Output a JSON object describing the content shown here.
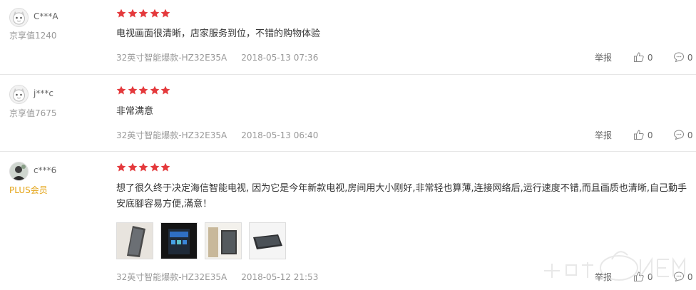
{
  "reviews": [
    {
      "user": "C***A",
      "level": "京享值1240",
      "rating": 5,
      "comment": "电视画面很清晰，店家服务到位，不错的购物体验",
      "product": "32英寸智能爆款-HZ32E35A",
      "date": "2018-05-13 07:36",
      "report_label": "举报",
      "likes": "0",
      "replies": "0"
    },
    {
      "user": "j***c",
      "level": "京享值7675",
      "rating": 5,
      "comment": "非常满意",
      "product": "32英寸智能爆款-HZ32E35A",
      "date": "2018-05-13 06:40",
      "report_label": "举报",
      "likes": "0",
      "replies": "0"
    },
    {
      "user": "c***6",
      "level": "PLUS会员",
      "rating": 5,
      "comment": "想了很久终于决定海信智能电视, 因为它是今年新款电视,房间用大小刚好,非常轻也算薄,连接网络后,运行速度不错,而且画质也清晰,自己動手安底腳容易方便,滿意！",
      "product": "32英寸智能爆款-HZ32E35A",
      "date": "2018-05-12 21:53",
      "report_label": "举报",
      "likes": "0",
      "replies": "0",
      "photo_count": 4
    }
  ],
  "colors": {
    "star": "#e4393c",
    "plus_level": "#e4a417",
    "meta": "#999999"
  },
  "icons": {
    "star": "star-icon",
    "like": "thumbs-up-icon",
    "reply": "comment-bubble-icon",
    "avatar": "default-avatar-icon"
  }
}
